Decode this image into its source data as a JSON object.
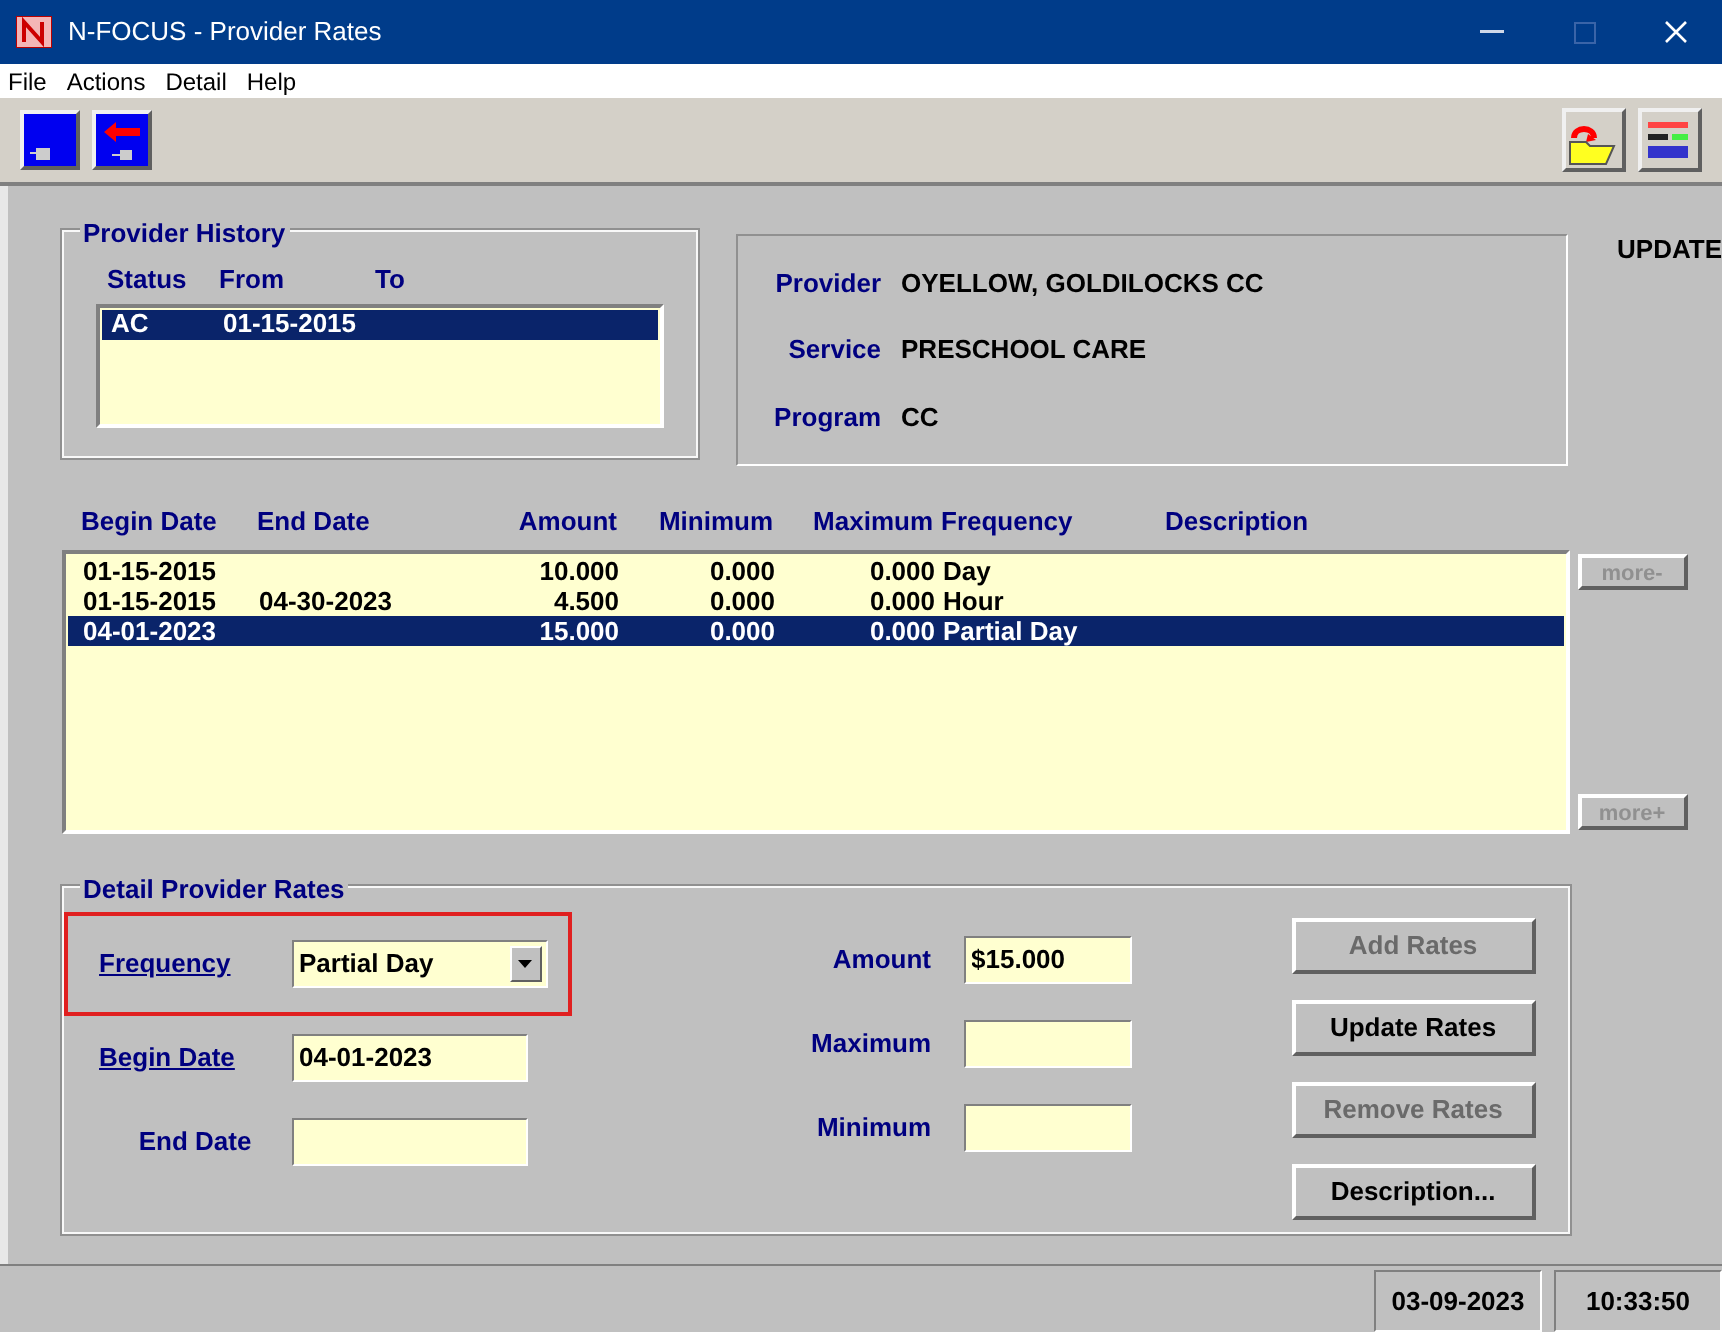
{
  "window": {
    "title": "N-FOCUS - Provider Rates"
  },
  "menu": [
    "File",
    "Actions",
    "Detail",
    "Help"
  ],
  "mode_label": "UPDATE",
  "provider_history": {
    "title": "Provider History",
    "columns": [
      "Status",
      "From",
      "To"
    ],
    "rows": [
      {
        "status": "AC",
        "from": "01-15-2015",
        "to": "",
        "selected": true
      }
    ]
  },
  "provider_info": [
    {
      "label": "Provider",
      "value": "OYELLOW, GOLDILOCKS CC"
    },
    {
      "label": "Service",
      "value": "PRESCHOOL CARE"
    },
    {
      "label": "Program",
      "value": "CC"
    }
  ],
  "rates_table": {
    "columns": [
      "Begin Date",
      "End Date",
      "Amount",
      "Minimum",
      "Maximum",
      "Frequency",
      "Description"
    ],
    "rows": [
      {
        "begin": "01-15-2015",
        "end": "",
        "amount": "10.000",
        "minimum": "0.000",
        "maximum": "0.000",
        "frequency": "Day",
        "selected": false
      },
      {
        "begin": "01-15-2015",
        "end": "04-30-2023",
        "amount": "4.500",
        "minimum": "0.000",
        "maximum": "0.000",
        "frequency": "Hour",
        "selected": false
      },
      {
        "begin": "04-01-2023",
        "end": "",
        "amount": "15.000",
        "minimum": "0.000",
        "maximum": "0.000",
        "frequency": "Partial Day",
        "selected": true
      }
    ]
  },
  "more_buttons": [
    {
      "label": "more-",
      "disabled": true
    },
    {
      "label": "more+",
      "disabled": true
    }
  ],
  "detail": {
    "title": "Detail Provider Rates",
    "frequency": {
      "label": "Frequency",
      "value": "Partial Day",
      "highlighted": true
    },
    "begin_date": {
      "label": "Begin Date",
      "value": "04-01-2023"
    },
    "end_date": {
      "label": "End Date"
    },
    "amount": {
      "label": "Amount",
      "value": "$15.000"
    },
    "maximum": {
      "label": "Maximum"
    },
    "minimum": {
      "label": "Minimum"
    },
    "buttons": [
      {
        "label": "Add Rates",
        "disabled": true
      },
      {
        "label": "Update Rates",
        "disabled": false
      },
      {
        "label": "Remove Rates",
        "disabled": true
      },
      {
        "label": "Description...",
        "disabled": false
      }
    ]
  },
  "status_bar": {
    "date": "03-09-2023",
    "time": "10:33:50"
  }
}
